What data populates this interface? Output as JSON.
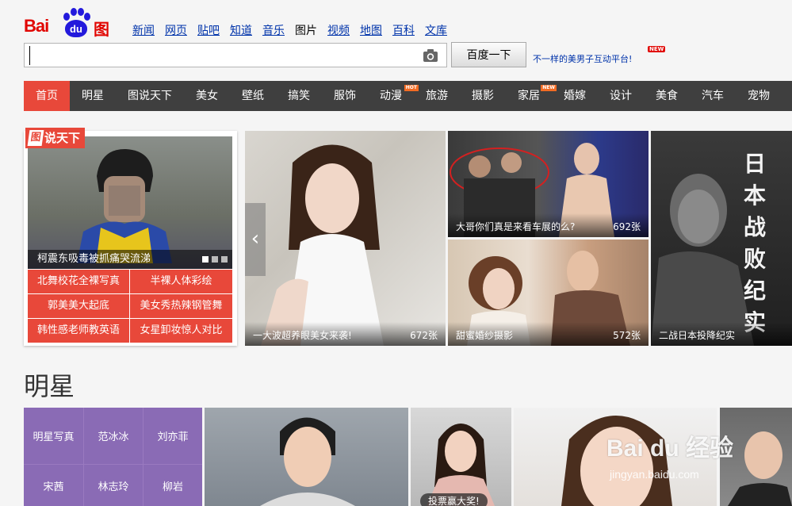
{
  "brand": {
    "logo_left": "Bai",
    "logo_paw": "du",
    "logo_right": "图片"
  },
  "topnav": [
    {
      "label": "新闻"
    },
    {
      "label": "网页"
    },
    {
      "label": "贴吧"
    },
    {
      "label": "知道"
    },
    {
      "label": "音乐"
    },
    {
      "label": "图片",
      "current": true
    },
    {
      "label": "视频"
    },
    {
      "label": "地图"
    },
    {
      "label": "百科"
    },
    {
      "label": "文库"
    }
  ],
  "search": {
    "value": "",
    "placeholder": "",
    "button_label": "百度一下"
  },
  "promo": {
    "text": "不一样的美男子互动平台!",
    "badge": "NEW"
  },
  "categories": [
    {
      "label": "首页",
      "active": true
    },
    {
      "label": "明星"
    },
    {
      "label": "图说天下"
    },
    {
      "label": "美女"
    },
    {
      "label": "壁纸"
    },
    {
      "label": "搞笑"
    },
    {
      "label": "服饰"
    },
    {
      "label": "动漫",
      "badge": "HOT"
    },
    {
      "label": "旅游"
    },
    {
      "label": "摄影"
    },
    {
      "label": "家居",
      "badge": "NEW"
    },
    {
      "label": "婚嫁"
    },
    {
      "label": "设计"
    },
    {
      "label": "美食"
    },
    {
      "label": "汽车"
    },
    {
      "label": "宠物"
    }
  ],
  "feature": {
    "tag_char": "图",
    "tag_rest": "说天下",
    "caption": "柯震东吸毒被抓痛哭流涕",
    "links": [
      "北舞校花全裸写真",
      "半裸人体彩绘",
      "郭美美大起底",
      "美女秀热辣钢管舞",
      "韩性感老师教英语",
      "女星卸妆惊人对比"
    ]
  },
  "tiles": [
    {
      "title": "一大波超养眼美女来袭!",
      "count": "672张"
    },
    {
      "title": "大哥你们真是来看车展的么?",
      "count": "692张"
    },
    {
      "title": "甜蜜婚纱摄影",
      "count": "572张"
    },
    {
      "title": "二战日本投降纪实",
      "count": ""
    }
  ],
  "t4_vertical": "日本战败纪实",
  "section_stars": {
    "title": "明星",
    "grid": [
      "明星写真",
      "范冰冰",
      "刘亦菲",
      "宋茜",
      "林志玲",
      "柳岩"
    ],
    "vote_badge": "投票赢大奖!"
  },
  "watermark": {
    "logo": "Bai du 经验",
    "url": "jingyan.baidu.com"
  },
  "colors": {
    "brand_red": "#e10602",
    "brand_blue": "#2319dc",
    "accent": "#e8483a",
    "navbar": "#3f3f3f",
    "star_purple": "#8a6bb5"
  }
}
